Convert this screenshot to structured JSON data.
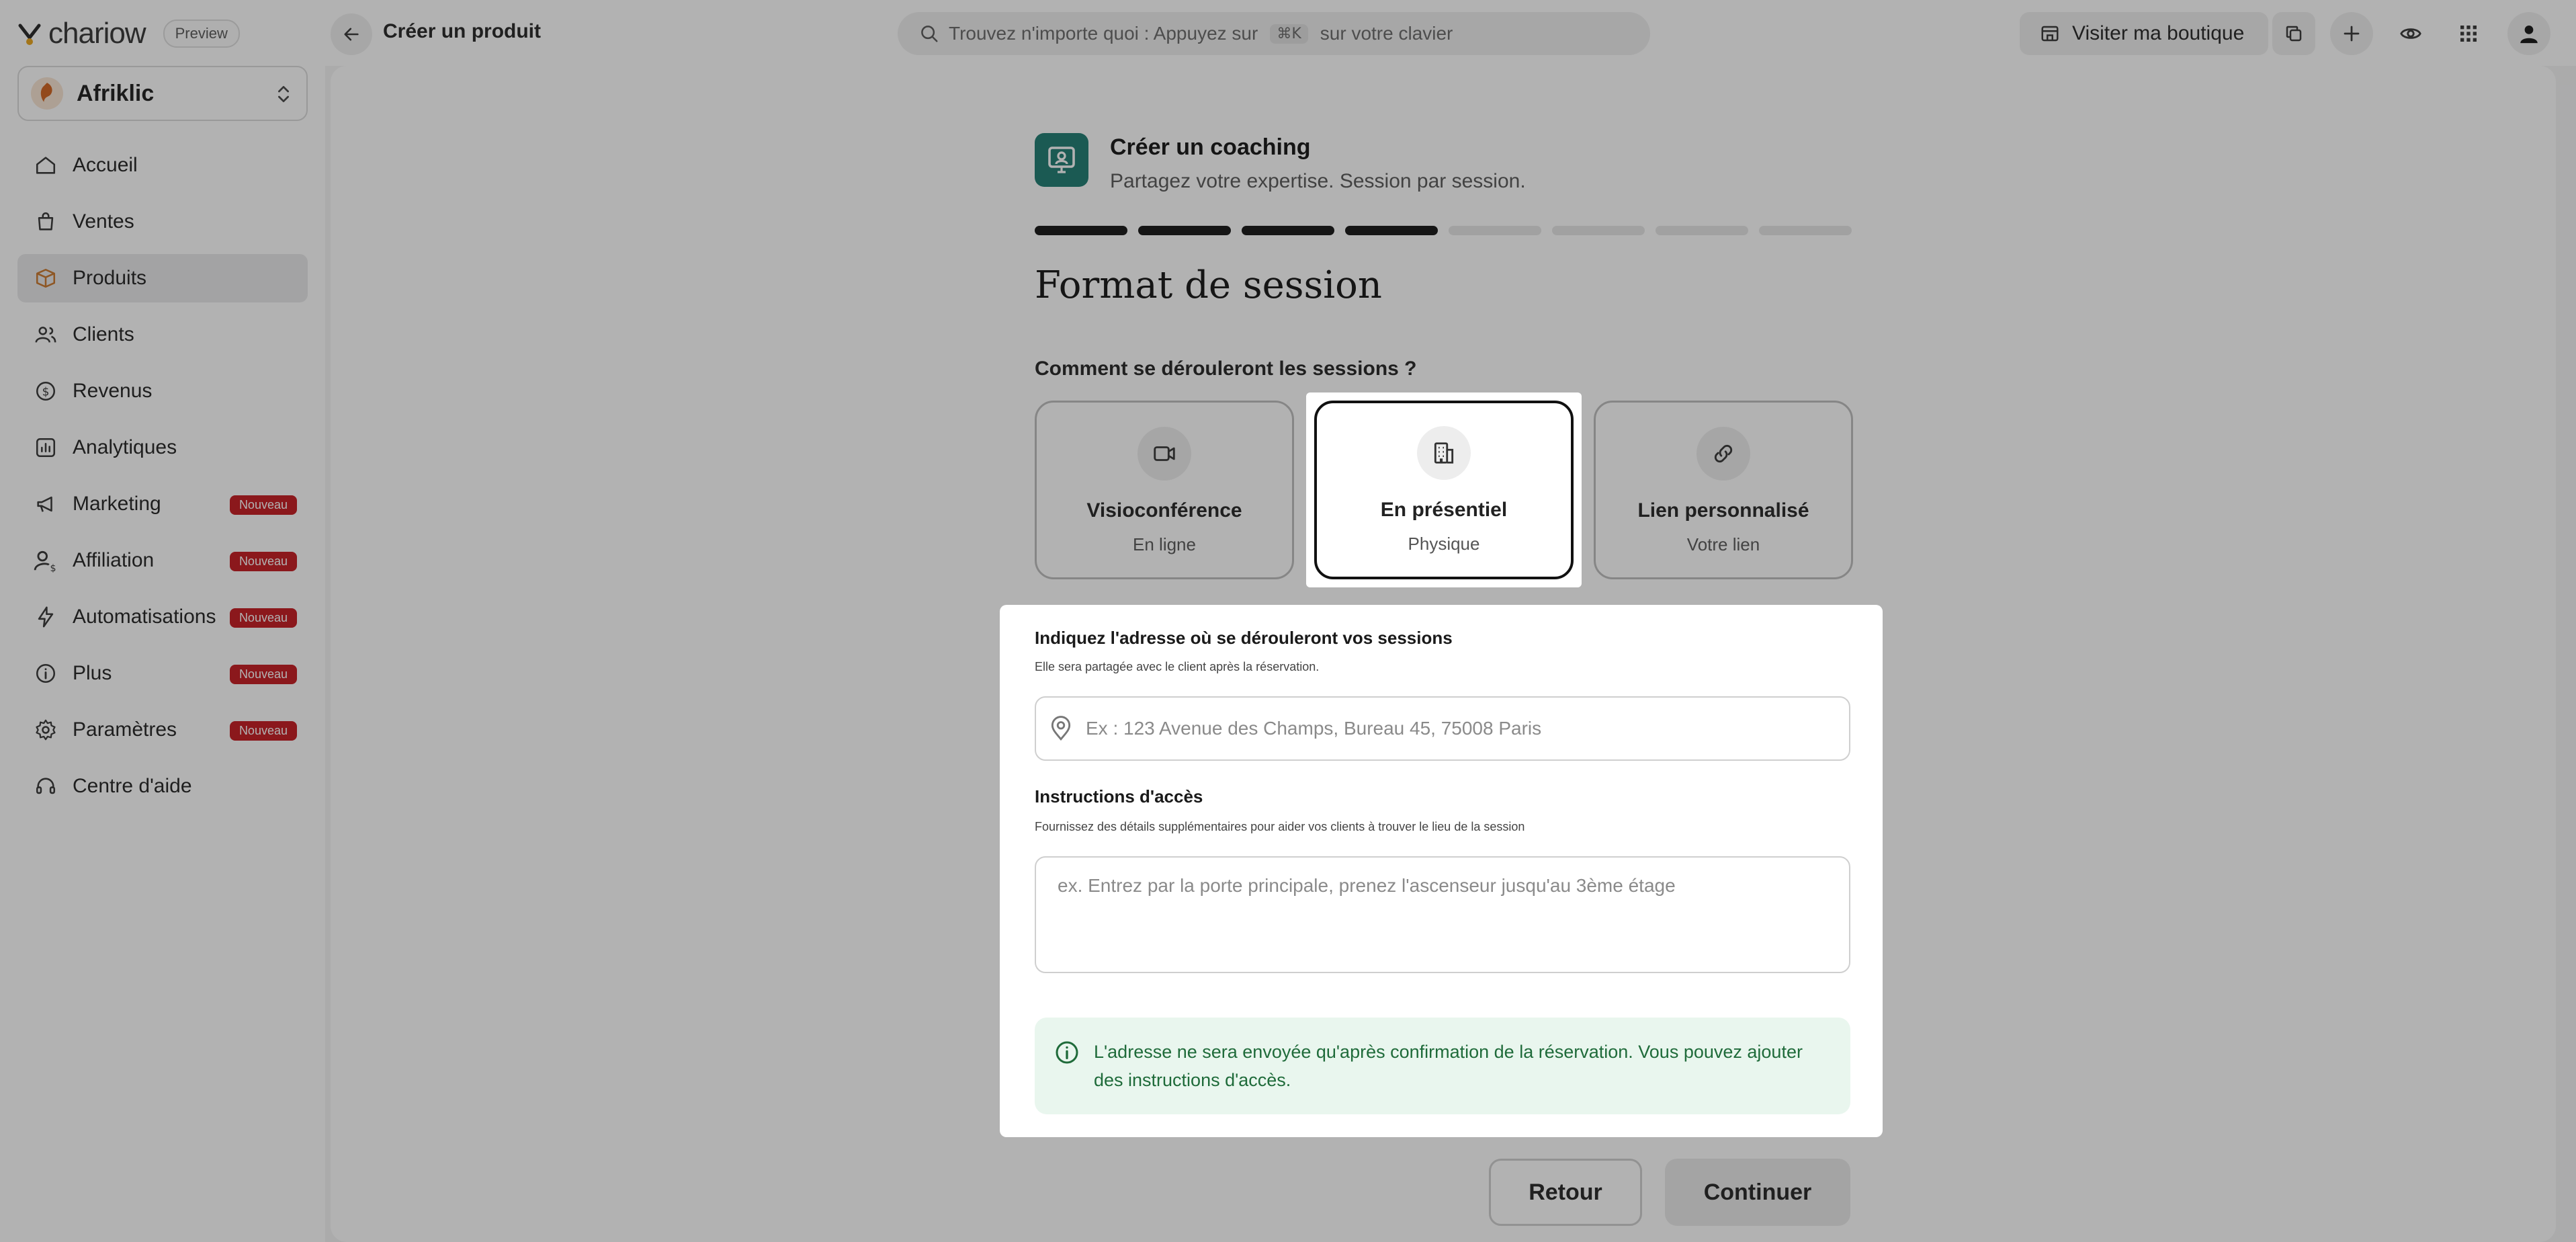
{
  "app": {
    "logo_text": "chariow",
    "preview_badge": "Preview",
    "page_heading": "Créer un produit",
    "search": {
      "prefix": "Trouvez n'importe quoi : Appuyez sur",
      "shortcut": "⌘K",
      "suffix": "sur votre clavier"
    },
    "visit_button": "Visiter ma boutique"
  },
  "sidebar": {
    "store_name": "Afriklic",
    "items": [
      {
        "label": "Accueil",
        "icon": "home-icon",
        "active": false,
        "badge": ""
      },
      {
        "label": "Ventes",
        "icon": "shopping-bag-icon",
        "active": false,
        "badge": ""
      },
      {
        "label": "Produits",
        "icon": "box-icon",
        "active": true,
        "badge": ""
      },
      {
        "label": "Clients",
        "icon": "users-icon",
        "active": false,
        "badge": ""
      },
      {
        "label": "Revenus",
        "icon": "dollar-icon",
        "active": false,
        "badge": ""
      },
      {
        "label": "Analytiques",
        "icon": "chart-icon",
        "active": false,
        "badge": ""
      },
      {
        "label": "Marketing",
        "icon": "megaphone-icon",
        "active": false,
        "badge": "Nouveau"
      },
      {
        "label": "Affiliation",
        "icon": "user-dollar-icon",
        "active": false,
        "badge": "Nouveau"
      },
      {
        "label": "Automatisations",
        "icon": "lightning-icon",
        "active": false,
        "badge": "Nouveau"
      },
      {
        "label": "Plus",
        "icon": "info-icon",
        "active": false,
        "badge": "Nouveau"
      },
      {
        "label": "Paramètres",
        "icon": "gear-icon",
        "active": false,
        "badge": "Nouveau"
      },
      {
        "label": "Centre d'aide",
        "icon": "headset-icon",
        "active": false,
        "badge": ""
      }
    ]
  },
  "product": {
    "title": "Créer un coaching",
    "subtitle": "Partagez votre expertise. Session par session.",
    "steps_total": 8,
    "steps_done": 4
  },
  "section": {
    "title": "Format de session",
    "question": "Comment se dérouleront les sessions ?"
  },
  "options": [
    {
      "title": "Visioconférence",
      "subtitle": "En ligne",
      "icon": "video-icon",
      "selected": false
    },
    {
      "title": "En présentiel",
      "subtitle": "Physique",
      "icon": "building-icon",
      "selected": true
    },
    {
      "title": "Lien personnalisé",
      "subtitle": "Votre lien",
      "icon": "link-icon",
      "selected": false
    }
  ],
  "address": {
    "label": "Indiquez l'adresse où se dérouleront vos sessions",
    "help": "Elle sera partagée avec le client après la réservation.",
    "placeholder": "Ex : 123 Avenue des Champs, Bureau 45, 75008 Paris"
  },
  "instructions": {
    "label": "Instructions d'accès",
    "help": "Fournissez des détails supplémentaires pour aider vos clients à trouver le lieu de la session",
    "placeholder": "ex. Entrez par la porte principale, prenez l'ascenseur jusqu'au 3ème étage"
  },
  "info": {
    "text": "L'adresse ne sera envoyée qu'après confirmation de la réservation. Vous pouvez ajouter des instructions d'accès."
  },
  "actions": {
    "back": "Retour",
    "continue": "Continuer"
  },
  "colors": {
    "accent_teal": "#1b7a70",
    "badge_red": "#c4161c",
    "info_bg": "#e9f6ee",
    "info_text": "#1f6b3a"
  }
}
